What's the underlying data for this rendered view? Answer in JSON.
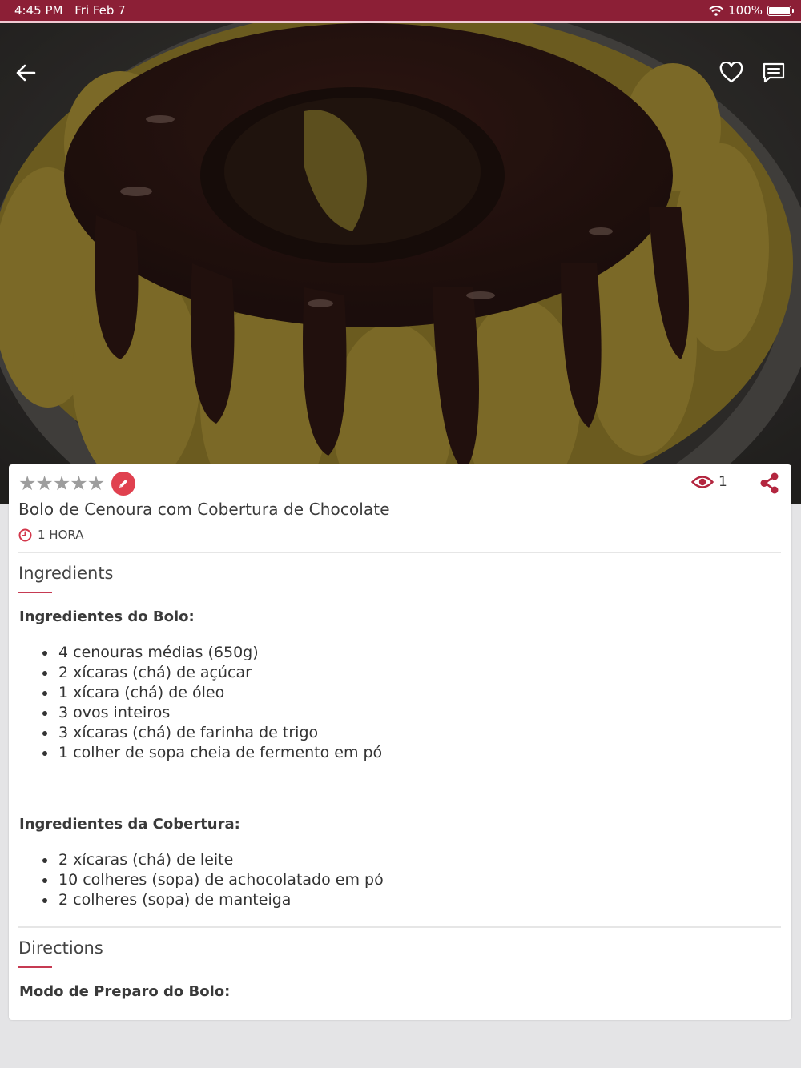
{
  "status_bar": {
    "time": "4:45 PM",
    "date": "Fri Feb 7",
    "battery": "100%"
  },
  "recipe": {
    "title": "Bolo de Cenoura com Cobertura de Chocolate",
    "time": "1 HORA",
    "rating_stars": 5,
    "rating_filled": 0,
    "views": "1"
  },
  "ingredients": {
    "heading": "Ingredients",
    "groups": [
      {
        "title": "Ingredientes do Bolo:",
        "items": [
          "4 cenouras médias (650g)",
          "2 xícaras (chá) de açúcar",
          "1 xícara (chá) de óleo",
          "3 ovos inteiros",
          "3 xícaras (chá) de farinha de trigo",
          "1 colher de sopa cheia de fermento em pó"
        ]
      },
      {
        "title": "Ingredientes da Cobertura:",
        "items": [
          "2 xícaras (chá) de leite",
          "10 colheres (sopa) de achocolatado em pó",
          "2 colheres (sopa) de manteiga"
        ]
      }
    ]
  },
  "directions": {
    "heading": "Directions",
    "subheading": "Modo de Preparo do Bolo:"
  },
  "colors": {
    "brand": "#8c1f36",
    "accent": "#e0414f",
    "underline": "#c63a52"
  },
  "icons": {
    "back": "arrow-left-icon",
    "favorite": "heart-icon",
    "comments": "chat-icon",
    "edit": "pencil-icon",
    "views": "eye-icon",
    "share": "share-icon",
    "time": "clock-icon"
  }
}
